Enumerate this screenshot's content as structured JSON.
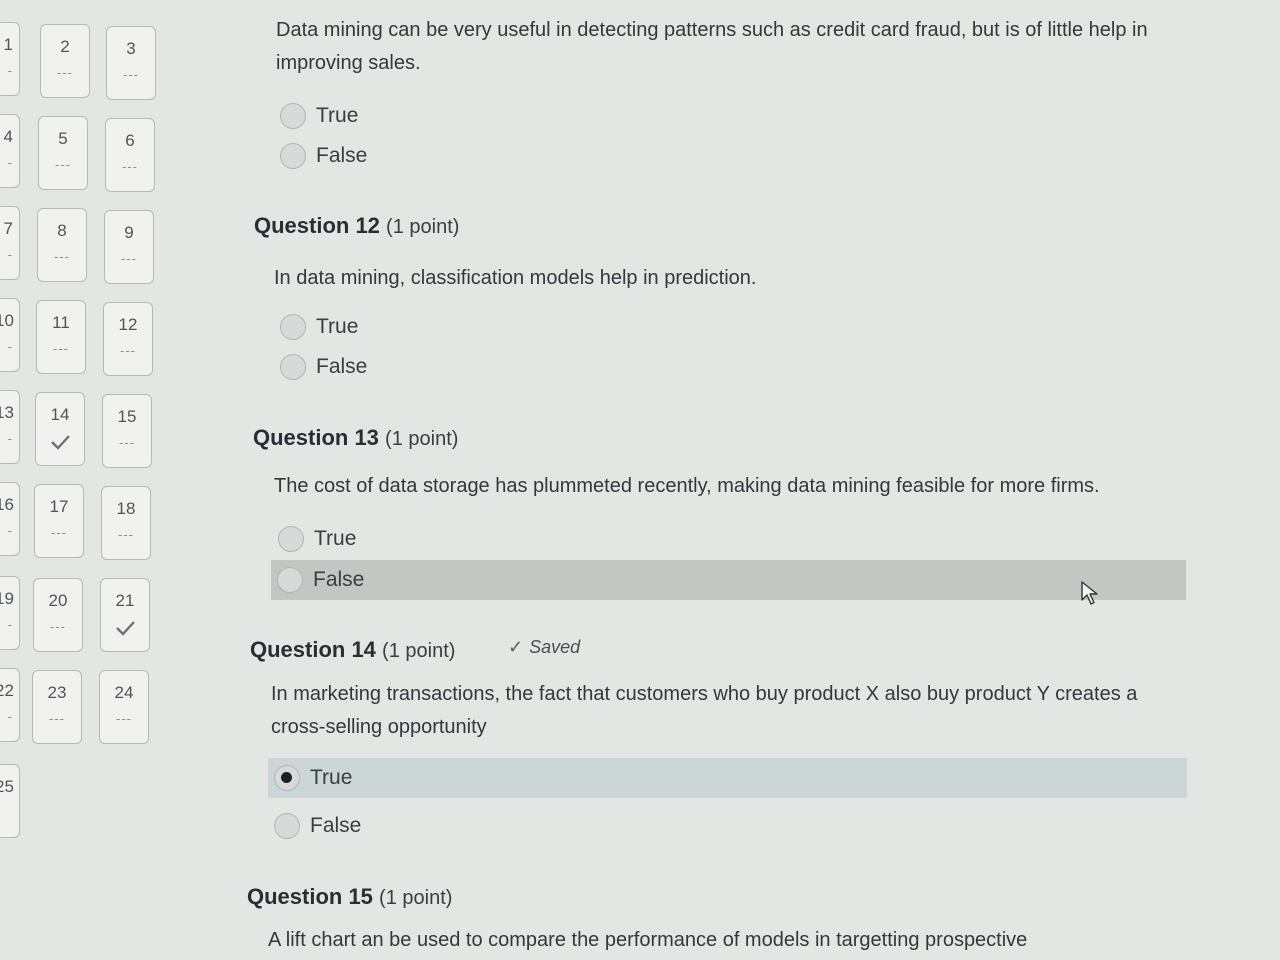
{
  "nav": {
    "tiles": [
      {
        "num": "2",
        "status": "---",
        "checked": false
      },
      {
        "num": "3",
        "status": "---",
        "checked": false
      },
      {
        "num": "5",
        "status": "---",
        "checked": false
      },
      {
        "num": "6",
        "status": "---",
        "checked": false
      },
      {
        "num": "8",
        "status": "---",
        "checked": false
      },
      {
        "num": "9",
        "status": "---",
        "checked": false
      },
      {
        "num": "11",
        "status": "---",
        "checked": false
      },
      {
        "num": "12",
        "status": "---",
        "checked": false
      },
      {
        "num": "14",
        "status": "",
        "checked": true
      },
      {
        "num": "15",
        "status": "---",
        "checked": false
      },
      {
        "num": "17",
        "status": "---",
        "checked": false
      },
      {
        "num": "18",
        "status": "---",
        "checked": false
      },
      {
        "num": "20",
        "status": "---",
        "checked": false
      },
      {
        "num": "21",
        "status": "",
        "checked": true
      },
      {
        "num": "23",
        "status": "---",
        "checked": false
      },
      {
        "num": "24",
        "status": "---",
        "checked": false
      }
    ],
    "partial_tiles": [
      {
        "num": "1"
      },
      {
        "num": "4"
      },
      {
        "num": "7"
      },
      {
        "num": "10"
      },
      {
        "num": "13"
      },
      {
        "num": "16"
      },
      {
        "num": "19"
      },
      {
        "num": "22"
      },
      {
        "num": "25"
      }
    ]
  },
  "q11": {
    "text": "Data mining can be very useful in detecting patterns such as credit card fraud, but is of little help in improving sales.",
    "options": [
      "True",
      "False"
    ]
  },
  "q12": {
    "title": "Question 12",
    "points": "(1 point)",
    "text": "In data mining, classification models help in prediction.",
    "options": [
      "True",
      "False"
    ]
  },
  "q13": {
    "title": "Question 13",
    "points": "(1 point)",
    "text": "The cost of data storage has plummeted recently, making data mining feasible for more firms.",
    "options": [
      "True",
      "False"
    ]
  },
  "q14": {
    "title": "Question 14",
    "points": "(1 point)",
    "saved": "Saved",
    "text": "In marketing transactions, the fact that customers who buy product X also buy product Y creates a cross-selling opportunity",
    "options": [
      "True",
      "False"
    ],
    "selected": "True"
  },
  "q15": {
    "title": "Question 15",
    "points": "(1 point)",
    "text": "A lift chart an be used to compare the performance of models in targetting prospective"
  },
  "colors": {
    "background": "#e4e6e4",
    "hover_row": "#c2c7c3",
    "selected_row": "#cdd6d7"
  }
}
